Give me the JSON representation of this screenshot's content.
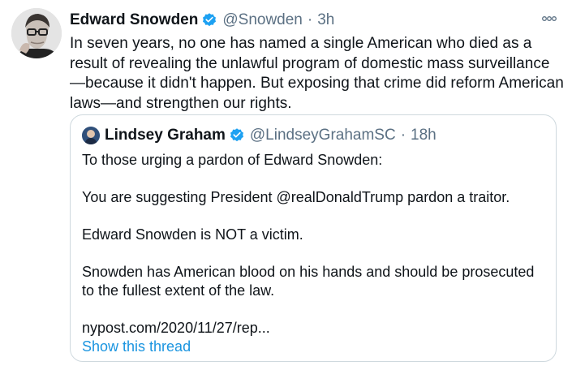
{
  "tweet": {
    "author_name": "Edward Snowden",
    "handle": "@Snowden",
    "separator": "·",
    "time": "3h",
    "text": "In seven years, no one has named a single American who died as a result of revealing the unlawful program of domestic mass surveillance—because it didn't happen. But exposing that crime did reform American laws—and strengthen our rights."
  },
  "quoted_tweet": {
    "author_name": "Lindsey Graham",
    "handle": "@LindseyGrahamSC",
    "separator": "·",
    "time": "18h",
    "lines": [
      "To those urging a pardon of Edward Snowden:",
      "You are suggesting President @realDonaldTrump pardon a traitor.",
      "Edward Snowden is NOT a victim.",
      "Snowden has American blood on his hands and should be prosecuted to the fullest extent of the law.",
      "nypost.com/2020/11/27/rep..."
    ],
    "show_thread": "Show this thread"
  },
  "colors": {
    "verified": "#1da1f2",
    "link": "#1b95e0",
    "muted": "#5b7083",
    "border": "#cfd9de"
  },
  "icons": [
    "verified-badge-icon",
    "more-options-icon"
  ]
}
